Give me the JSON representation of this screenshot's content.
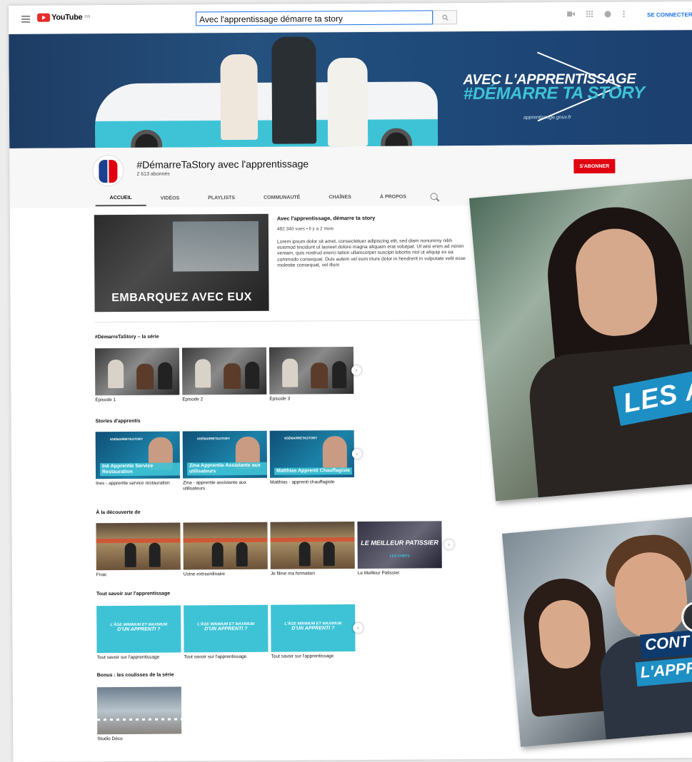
{
  "topbar": {
    "logo_text": "YouTube",
    "logo_region": "FR",
    "search_value": "Avec l'apprentissage démarre ta story",
    "signin_label": "SE CONNECTER"
  },
  "banner": {
    "slogan_line1": "AVEC L'APPRENTISSAGE",
    "slogan_line2": "#DÉMARRE TA STORY",
    "url": "apprentissage.gouv.fr"
  },
  "channel": {
    "title": "#DémarreTaStory avec l'apprentissage",
    "subscribers": "2 613 abonnés",
    "subscribe_label": "S'ABONNER",
    "tabs": [
      "ACCUEIL",
      "VIDÉOS",
      "PLAYLISTS",
      "COMMUNAUTÉ",
      "CHAÎNES",
      "À PROPOS"
    ]
  },
  "featured": {
    "thumb_caption": "EMBARQUEZ AVEC EUX",
    "title": "Avec l'apprentissage, démarre ta story",
    "meta": "482 340 vues • il y a 2 mois",
    "description": "Lorem ipsum dolor sit amet, consectetuer adipiscing elit, sed diam nonummy nibh euismod tincidunt ut laoreet dolore magna aliquam erat volutpat. Ut wisi enim ad minim veniam, quis nostrud exerci tation ullamcorper suscipit lobortis nisl ut aliquip ex ea commodo consequat. Duis autem vel eum iriure dolor in hendrerit in vulputate velit esse molestie consequat, vel illum"
  },
  "sections": [
    {
      "title": "#DémarreTaStory – la série",
      "items": [
        "Épisode 1",
        "Épisode 2",
        "Épisode 3"
      ]
    },
    {
      "title": "Stories d'apprentis",
      "items": [
        "Ines - apprentie service restauration",
        "Zina - apprentie assistante aux utilisateurs",
        "Matthias - apprenti chauffagiste"
      ],
      "thumb_names": [
        "Inè Apprentie Service Restauration",
        "Zina Apprentie Assistante aux utilisateurs",
        "Matthias Apprenti Chauffagiste"
      ],
      "thumb_logo": "#DÉMARRETASTORY"
    },
    {
      "title": "À la découverte de",
      "items": [
        "Fnac",
        "Usine extraordinaire",
        "Je filme ma formation",
        "Le Meilleur Patissier"
      ],
      "chef_title": "LE MEILLEUR PATISSIER",
      "chef_sub": "LES CHEFS"
    },
    {
      "title": "Tout savoir sur l'apprentissage",
      "items": [
        "Tout savoir sur l'apprentissage",
        "Tout savoir sur l'apprentissage",
        "Tout savoir sur l'apprentissage"
      ],
      "thumb_text_1": "L'ÂGE MINIMUM ET MAXIMUM",
      "thumb_text_2": "D'UN APPRENTI ?"
    },
    {
      "title": "Bonus : les coulisses de la série",
      "items": [
        "Studio Déco"
      ]
    }
  ],
  "promo": {
    "photo1_band": "LES A",
    "photo2_band1": "CONT",
    "photo2_band2": "L'APPR"
  },
  "colors": {
    "accent": "#1a73e8",
    "subscribe": "#e1000f",
    "brand_cyan": "#3ec3d6",
    "brand_navy": "#1c3f6e"
  }
}
